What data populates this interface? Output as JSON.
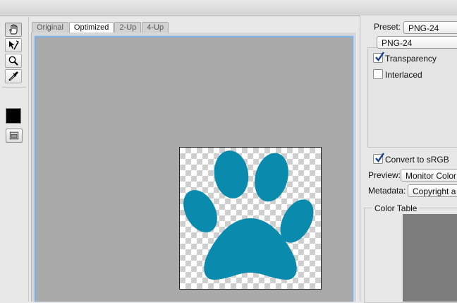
{
  "tabs": [
    "Original",
    "Optimized",
    "2-Up",
    "4-Up"
  ],
  "active_tab": "Optimized",
  "toolbar": {
    "tools": [
      "hand-tool",
      "slice-select-tool",
      "zoom-tool",
      "eyedropper-tool"
    ],
    "eyedropper_color": "#000000"
  },
  "settings": {
    "preset_label": "Preset:",
    "preset_value": "PNG-24",
    "format_value": "PNG-24",
    "transparency_label": "Transparency",
    "transparency_checked": true,
    "interlaced_label": "Interlaced",
    "interlaced_checked": false,
    "convert_srgb_label": "Convert to sRGB",
    "convert_srgb_checked": true,
    "preview_label": "Preview:",
    "preview_value": "Monitor Color",
    "metadata_label": "Metadata:",
    "metadata_value": "Copyright a"
  },
  "color_table": {
    "title": "Color Table"
  },
  "colors": {
    "paw": "#0a8aad",
    "canvas": "#a9a9a9",
    "focus": "#7fb2e6"
  }
}
